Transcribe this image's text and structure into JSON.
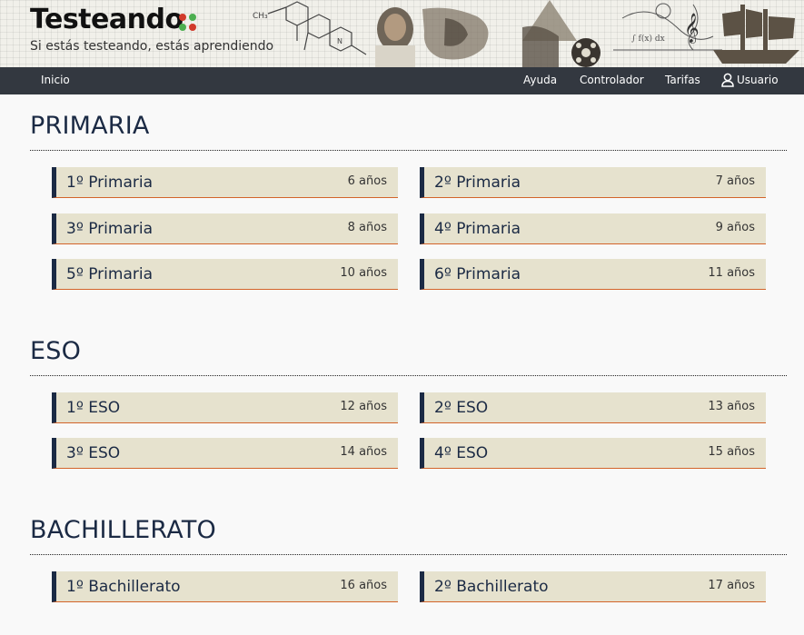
{
  "header": {
    "title": "Testeando",
    "subtitle": "Si estás testeando, estás aprendiendo",
    "dot_colors": [
      "#d13a2b",
      "#4caf50",
      "#4caf50",
      "#d13a2b"
    ]
  },
  "nav": {
    "home": "Inicio",
    "help": "Ayuda",
    "controller": "Controlador",
    "rates": "Tarifas",
    "user": "Usuario"
  },
  "sections": [
    {
      "title": "PRIMARIA",
      "items": [
        {
          "name": "1º Primaria",
          "age": "6 años"
        },
        {
          "name": "2º Primaria",
          "age": "7 años"
        },
        {
          "name": "3º Primaria",
          "age": "8 años"
        },
        {
          "name": "4º Primaria",
          "age": "9 años"
        },
        {
          "name": "5º Primaria",
          "age": "10 años"
        },
        {
          "name": "6º Primaria",
          "age": "11 años"
        }
      ]
    },
    {
      "title": "ESO",
      "items": [
        {
          "name": "1º ESO",
          "age": "12 años"
        },
        {
          "name": "2º ESO",
          "age": "13 años"
        },
        {
          "name": "3º ESO",
          "age": "14 años"
        },
        {
          "name": "4º ESO",
          "age": "15 años"
        }
      ]
    },
    {
      "title": "BACHILLERATO",
      "items": [
        {
          "name": "1º Bachillerato",
          "age": "16 años"
        },
        {
          "name": "2º Bachillerato",
          "age": "17 años"
        }
      ]
    }
  ],
  "colors": {
    "navbar": "#333840",
    "card_bg": "#e6e2ce",
    "card_accent": "#1b2a44",
    "card_underline": "#d3642a",
    "text_primary": "#1b2a44"
  }
}
